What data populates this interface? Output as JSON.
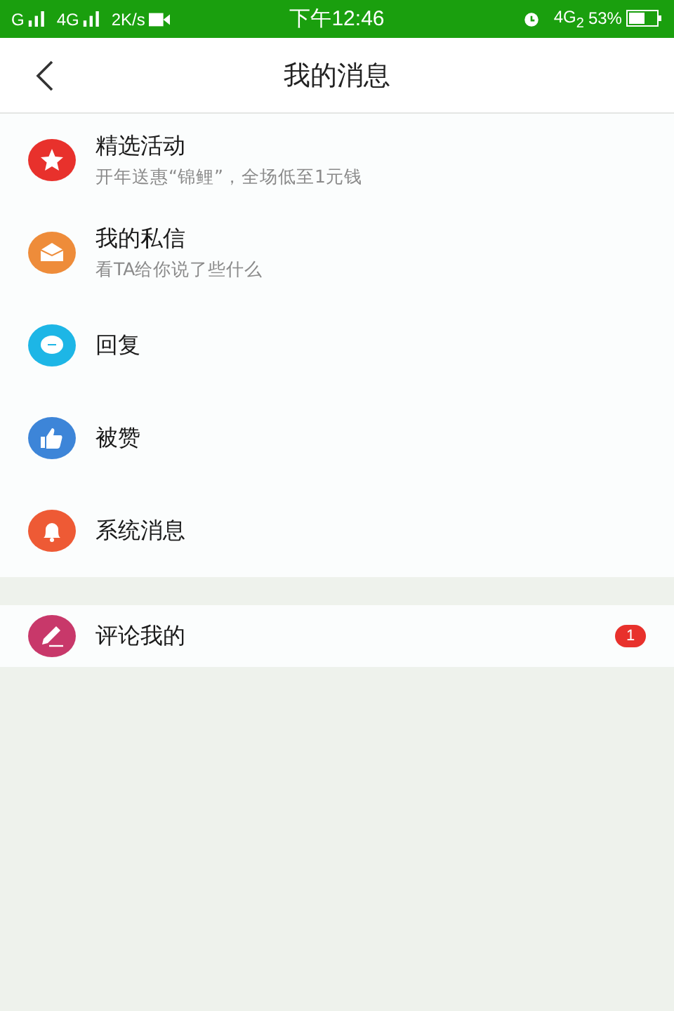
{
  "status_bar": {
    "carrier_1": "G",
    "carrier_2": "4G",
    "speed": "2K/s",
    "time": "下午12:46",
    "network": "4G$_{2}$",
    "battery": "53%"
  },
  "header": {
    "title": "我的消息"
  },
  "sections": [
    {
      "items": [
        {
          "kind": "star",
          "color": "#e8312c",
          "title": "精选活动",
          "subtitle": "开年送惠“锦鲤”，全场低至1元钱"
        },
        {
          "kind": "mail",
          "color": "#ee8c3a",
          "title": "我的私信",
          "subtitle": "看TA给你说了些什么"
        },
        {
          "kind": "chat",
          "color": "#1db6e6",
          "title": "回复"
        },
        {
          "kind": "thumb",
          "color": "#3d85d8",
          "title": "被赞"
        },
        {
          "kind": "bell",
          "color": "#ee5a35",
          "title": "系统消息"
        }
      ]
    },
    {
      "items": [
        {
          "kind": "pencil",
          "color": "#c8386a",
          "title": "评论我的",
          "badge": "1"
        }
      ]
    }
  ]
}
